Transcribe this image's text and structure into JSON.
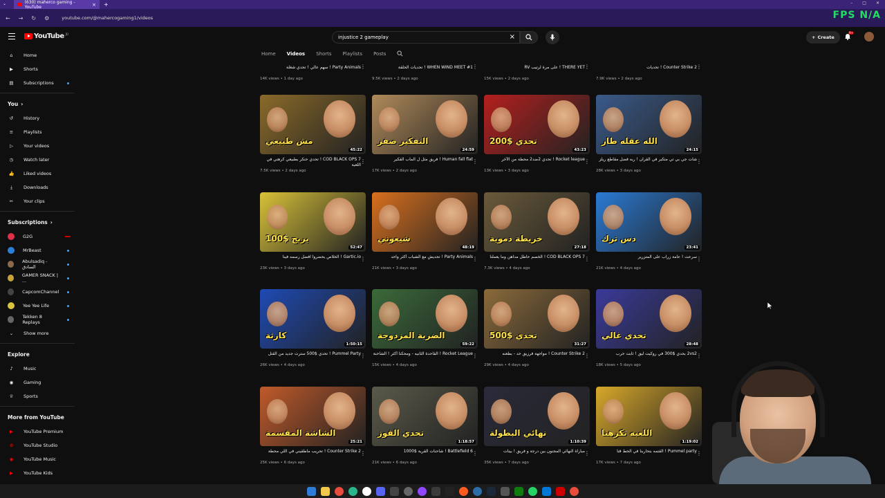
{
  "browser": {
    "tab_title": "(630) maherco gaming - YouTube",
    "url": "youtube.com/@mahercogaming1/videos",
    "overlay_text": "FPS N/A"
  },
  "masthead": {
    "logo_text": "YouTube",
    "country": "JO",
    "search_value": "injustice 2 gameplay",
    "create_label": "Create",
    "notif_count": "9+"
  },
  "sidebar": {
    "main": [
      {
        "label": "Home",
        "icon": "home-icon"
      },
      {
        "label": "Shorts",
        "icon": "shorts-icon"
      },
      {
        "label": "Subscriptions",
        "icon": "subscriptions-icon"
      }
    ],
    "you_heading": "You",
    "you": [
      {
        "label": "History"
      },
      {
        "label": "Playlists"
      },
      {
        "label": "Your videos"
      },
      {
        "label": "Watch later"
      },
      {
        "label": "Liked videos"
      },
      {
        "label": "Downloads"
      },
      {
        "label": "Your clips"
      }
    ],
    "subs_heading": "Subscriptions",
    "subs": [
      {
        "label": "G2G",
        "color": "#e0314a"
      },
      {
        "label": "MrBeast",
        "color": "#2a7fd4"
      },
      {
        "label": "Abulsadiq - السادق",
        "color": "#8a6a4a"
      },
      {
        "label": "GAMER SNACK | ...",
        "color": "#c7a23a"
      },
      {
        "label": "CapcomChannel",
        "color": "#444444"
      },
      {
        "label": "Yee Yee Life",
        "color": "#d8c640"
      },
      {
        "label": "Tekken 8 Replays",
        "color": "#666666"
      }
    ],
    "show_more": "Show more",
    "explore_heading": "Explore",
    "explore": [
      {
        "label": "Music"
      },
      {
        "label": "Gaming"
      },
      {
        "label": "Sports"
      }
    ],
    "more_heading": "More from YouTube",
    "more": [
      {
        "label": "YouTube Premium"
      },
      {
        "label": "YouTube Studio"
      },
      {
        "label": "YouTube Music"
      },
      {
        "label": "YouTube Kids"
      }
    ]
  },
  "channel_tabs": [
    "Home",
    "Videos",
    "Shorts",
    "Playlists",
    "Posts"
  ],
  "partial_row": [
    {
      "title": "Party Animals ! سهم عالي ! تحدي شغلة",
      "meta": "14K views • 1 day ago"
    },
    {
      "title": "WHEN WIND MEET #1 ! تحديات الحلقة",
      "meta": "9.5K views • 2 days ago"
    },
    {
      "title": "THERE YET ! على مرة لرتيب RV",
      "meta": "15K views • 2 days ago"
    },
    {
      "title": "Counter Strike 2 ! تحديات",
      "meta": "7.9K views • 2 days ago"
    }
  ],
  "videos": [
    {
      "title": "COD BLACK OPS 7 ! تحدي حنكر بطبيعي كرهني في اللعبة",
      "meta": "7.5K views • 2 days ago",
      "duration": "45:22",
      "text": "مش طبيعي",
      "bg": "#8a6a2a"
    },
    {
      "title": "Human fall flat ! فريق مثل ل الماب الفكير",
      "meta": "17K views • 2 days ago",
      "duration": "24:59",
      "text": "التفكير صفر",
      "bg": "#b08a5a"
    },
    {
      "title": "Rocket league ! تحدي 2ضد2 محطة من الآخر",
      "meta": "13K views • 3 days ago",
      "duration": "43:23",
      "text": "تحدي $200",
      "bg": "#b4201e"
    },
    {
      "title": "شات جي بي تي متكبر في القرآن ! ربه فضل مقاطع ريلز",
      "meta": "28K views • 3 days ago",
      "duration": "24:15",
      "text": "الله عقله طار",
      "bg": "#3a5a8a"
    },
    {
      "title": "Gartic.io ! الخلاص يحضروا افضل رسمه فينا",
      "meta": "23K views • 3 days ago",
      "duration": "52:47",
      "text": "يربح $100",
      "bg": "#d8c238"
    },
    {
      "title": "Party Animals ! تحديش مع الشباب أكثر واحد",
      "meta": "21K views • 3 days ago",
      "duration": "48:19",
      "text": "شيعوني",
      "bg": "#d9701e"
    },
    {
      "title": "COD BLACK OPS 7 ! الخصم حاطل مداهن وما يعملنا",
      "meta": "7.3K views • 4 days ago",
      "duration": "27:18",
      "text": "خريطة دموية",
      "bg": "#6a5a3a"
    },
    {
      "title": "سرعت ! عامة زراب على المتزرير",
      "meta": "21K views • 4 days ago",
      "duration": "23:41",
      "text": "دس ترك",
      "bg": "#2a7ad4"
    },
    {
      "title": "Pummel Party ! تحدي $500 سترت جديد من القتل",
      "meta": "26K views • 4 days ago",
      "duration": "1:50:15",
      "text": "كارثة",
      "bg": "#1e4ab4"
    },
    {
      "title": "Rocket League ! القاحدة الثانيه - ومحكنا أكثر ! الشاحنة",
      "meta": "15K views • 4 days ago",
      "duration": "59:22",
      "text": "الضربة المزدوجة",
      "bg": "#3a6a3a"
    },
    {
      "title": "Counter Strike 2 ! مواجهة فرزيق حد - بطعنه",
      "meta": "29K views • 4 days ago",
      "duration": "31:27",
      "text": "تحدي $500",
      "bg": "#8a6a3a"
    },
    {
      "title": "2vs2 بحدي $300 في روكيت ليق ! ثابت حرب",
      "meta": "18K views • 5 days ago",
      "duration": "28:48",
      "text": "تحدي غالي",
      "bg": "#3a3a9a"
    },
    {
      "title": "Counter Strike 2 ! تحريب ماطقيني في اللي محطة",
      "meta": "25K views • 6 days ago",
      "duration": "25:21",
      "text": "الشاشة المقسمة",
      "bg": "#c05a2a"
    },
    {
      "title": "Battlefield 6 ! شاحنات القرية $1000",
      "meta": "21K views • 6 days ago",
      "duration": "1:18:57",
      "text": "تحدي الفوز",
      "bg": "#5a5a4a"
    },
    {
      "title": "مباراة النهائي المجنون بين درجة و فريق ! بينات",
      "meta": "35K views • 7 days ago",
      "duration": "1:10:39",
      "text": "نهائي البطولة",
      "bg": "#2a2a3a"
    },
    {
      "title": "Pummel party ! القتمه بتحاربنا في الحط قتا",
      "meta": "17K views • 7 days ago",
      "duration": "1:19:02",
      "text": "اللعبه تكرهنا",
      "bg": "#d8a82a"
    }
  ]
}
